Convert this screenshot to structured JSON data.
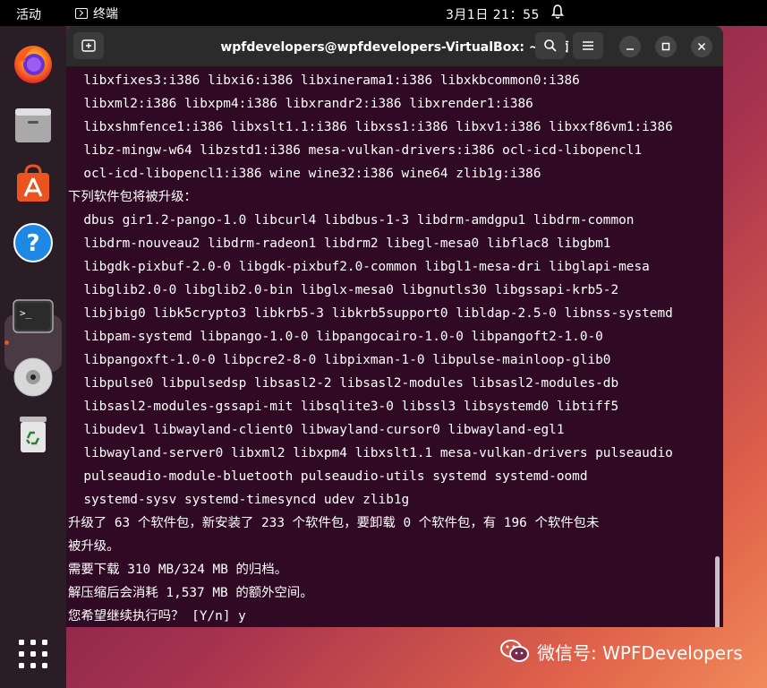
{
  "topbar": {
    "activities": "活动",
    "app_name": "终端",
    "clock": "3月1日 21：55"
  },
  "dock": {
    "items": [
      "firefox-icon",
      "files-icon",
      "app-center-icon",
      "help-icon",
      "terminal-icon",
      "disc-icon",
      "trash-icon"
    ]
  },
  "window": {
    "title": "wpfdevelopers@wpfdevelopers-VirtualBox: ~/桌面"
  },
  "terminal": {
    "lines": [
      "  libxfixes3:i386 libxi6:i386 libxinerama1:i386 libxkbcommon0:i386",
      "  libxml2:i386 libxpm4:i386 libxrandr2:i386 libxrender1:i386",
      "  libxshmfence1:i386 libxslt1.1:i386 libxss1:i386 libxv1:i386 libxxf86vm1:i386",
      "  libz-mingw-w64 libzstd1:i386 mesa-vulkan-drivers:i386 ocl-icd-libopencl1",
      "  ocl-icd-libopencl1:i386 wine wine32:i386 wine64 zlib1g:i386",
      "下列软件包将被升级：",
      "  dbus gir1.2-pango-1.0 libcurl4 libdbus-1-3 libdrm-amdgpu1 libdrm-common",
      "  libdrm-nouveau2 libdrm-radeon1 libdrm2 libegl-mesa0 libflac8 libgbm1",
      "  libgdk-pixbuf-2.0-0 libgdk-pixbuf2.0-common libgl1-mesa-dri libglapi-mesa",
      "  libglib2.0-0 libglib2.0-bin libglx-mesa0 libgnutls30 libgssapi-krb5-2",
      "  libjbig0 libk5crypto3 libkrb5-3 libkrb5support0 libldap-2.5-0 libnss-systemd",
      "  libpam-systemd libpango-1.0-0 libpangocairo-1.0-0 libpangoft2-1.0-0",
      "  libpangoxft-1.0-0 libpcre2-8-0 libpixman-1-0 libpulse-mainloop-glib0",
      "  libpulse0 libpulsedsp libsasl2-2 libsasl2-modules libsasl2-modules-db",
      "  libsasl2-modules-gssapi-mit libsqlite3-0 libssl3 libsystemd0 libtiff5",
      "  libudev1 libwayland-client0 libwayland-cursor0 libwayland-egl1",
      "  libwayland-server0 libxml2 libxpm4 libxslt1.1 mesa-vulkan-drivers pulseaudio",
      "  pulseaudio-module-bluetooth pulseaudio-utils systemd systemd-oomd",
      "  systemd-sysv systemd-timesyncd udev zlib1g",
      "升级了 63 个软件包，新安装了 233 个软件包，要卸载 0 个软件包，有 196 个软件包未",
      "被升级。",
      "需要下载 310 MB/324 MB 的归档。",
      "解压缩后会消耗 1,537 MB 的额外空间。",
      "您希望继续执行吗？ [Y/n] y"
    ]
  },
  "watermark": {
    "text": "微信号: WPFDevelopers"
  },
  "colors": {
    "terminal_bg": "#300a24",
    "titlebar_bg": "#2b2b2b",
    "dock_bg": "#2b1d26",
    "accent": "#e95420"
  }
}
